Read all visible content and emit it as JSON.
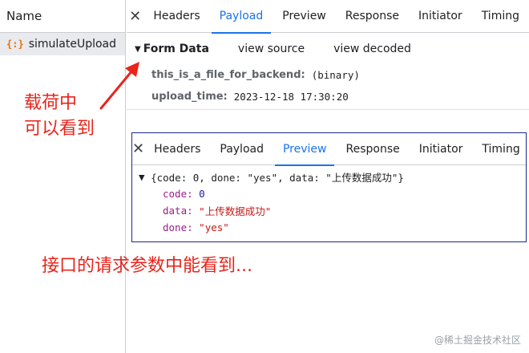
{
  "left_panel": {
    "header": "Name",
    "request": {
      "icon": "json-braces-icon",
      "icon_text": "{:}",
      "name": "simulateUpload"
    }
  },
  "tabs": {
    "close": "✕",
    "items": [
      "Headers",
      "Payload",
      "Preview",
      "Response",
      "Initiator",
      "Timing"
    ],
    "active": "Payload"
  },
  "form_data": {
    "title": "Form Data",
    "view_source": "view source",
    "view_decoded": "view decoded",
    "rows": [
      {
        "key": "this_is_a_file_for_backend:",
        "value": "(binary)"
      },
      {
        "key": "upload_time:",
        "value": "2023-12-18 17:30:20"
      }
    ]
  },
  "preview_panel": {
    "tabs": [
      "Headers",
      "Payload",
      "Preview",
      "Response",
      "Initiator",
      "Timing"
    ],
    "active": "Preview",
    "summary": "{code: 0, done: \"yes\", data: \"上传数据成功\"}",
    "fields": [
      {
        "key": "code:",
        "value": "0",
        "kind": "num"
      },
      {
        "key": "data:",
        "value": "\"上传数据成功\"",
        "kind": "str"
      },
      {
        "key": "done:",
        "value": "\"yes\"",
        "kind": "str"
      }
    ]
  },
  "annotations": {
    "note1_line1": "载荷中",
    "note1_line2": "可以看到",
    "note2": "接口的请求参数中能看到...",
    "color": "#e8241b"
  },
  "watermark": "@稀土掘金技术社区",
  "colors": {
    "accent": "#1a73e8",
    "border": "#1b2a8b"
  }
}
